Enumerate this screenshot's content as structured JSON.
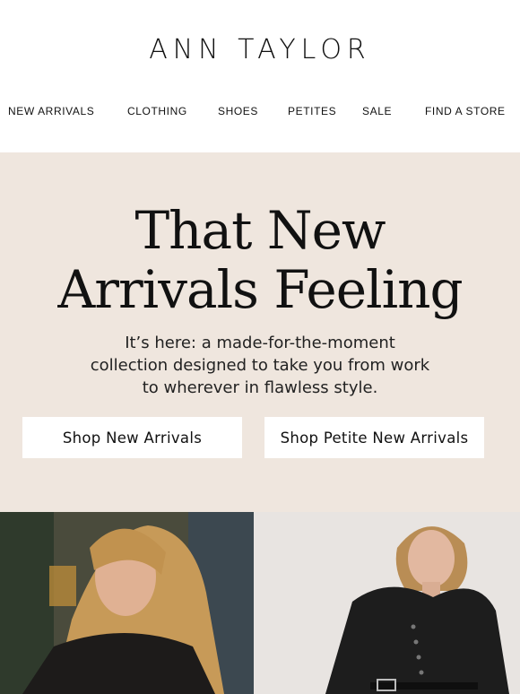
{
  "brand": {
    "logo_text": "ANN TAYLOR"
  },
  "nav": {
    "items": [
      {
        "label": "NEW ARRIVALS"
      },
      {
        "label": "CLOTHING"
      },
      {
        "label": "SHOES"
      },
      {
        "label": "PETITES"
      },
      {
        "label": "SALE"
      },
      {
        "label": "FIND A STORE"
      }
    ]
  },
  "hero": {
    "headline_line1": "That New",
    "headline_line2": "Arrivals Feeling",
    "sub_line1": "It’s here: a made-for-the-moment",
    "sub_line2": "collection designed to take you from work",
    "sub_line3": "to wherever in flawless style.",
    "cta_primary": "Shop New Arrivals",
    "cta_secondary": "Shop Petite New Arrivals",
    "background_color": "#efe6de"
  },
  "colors": {
    "text": "#111111",
    "button_bg": "#ffffff"
  }
}
